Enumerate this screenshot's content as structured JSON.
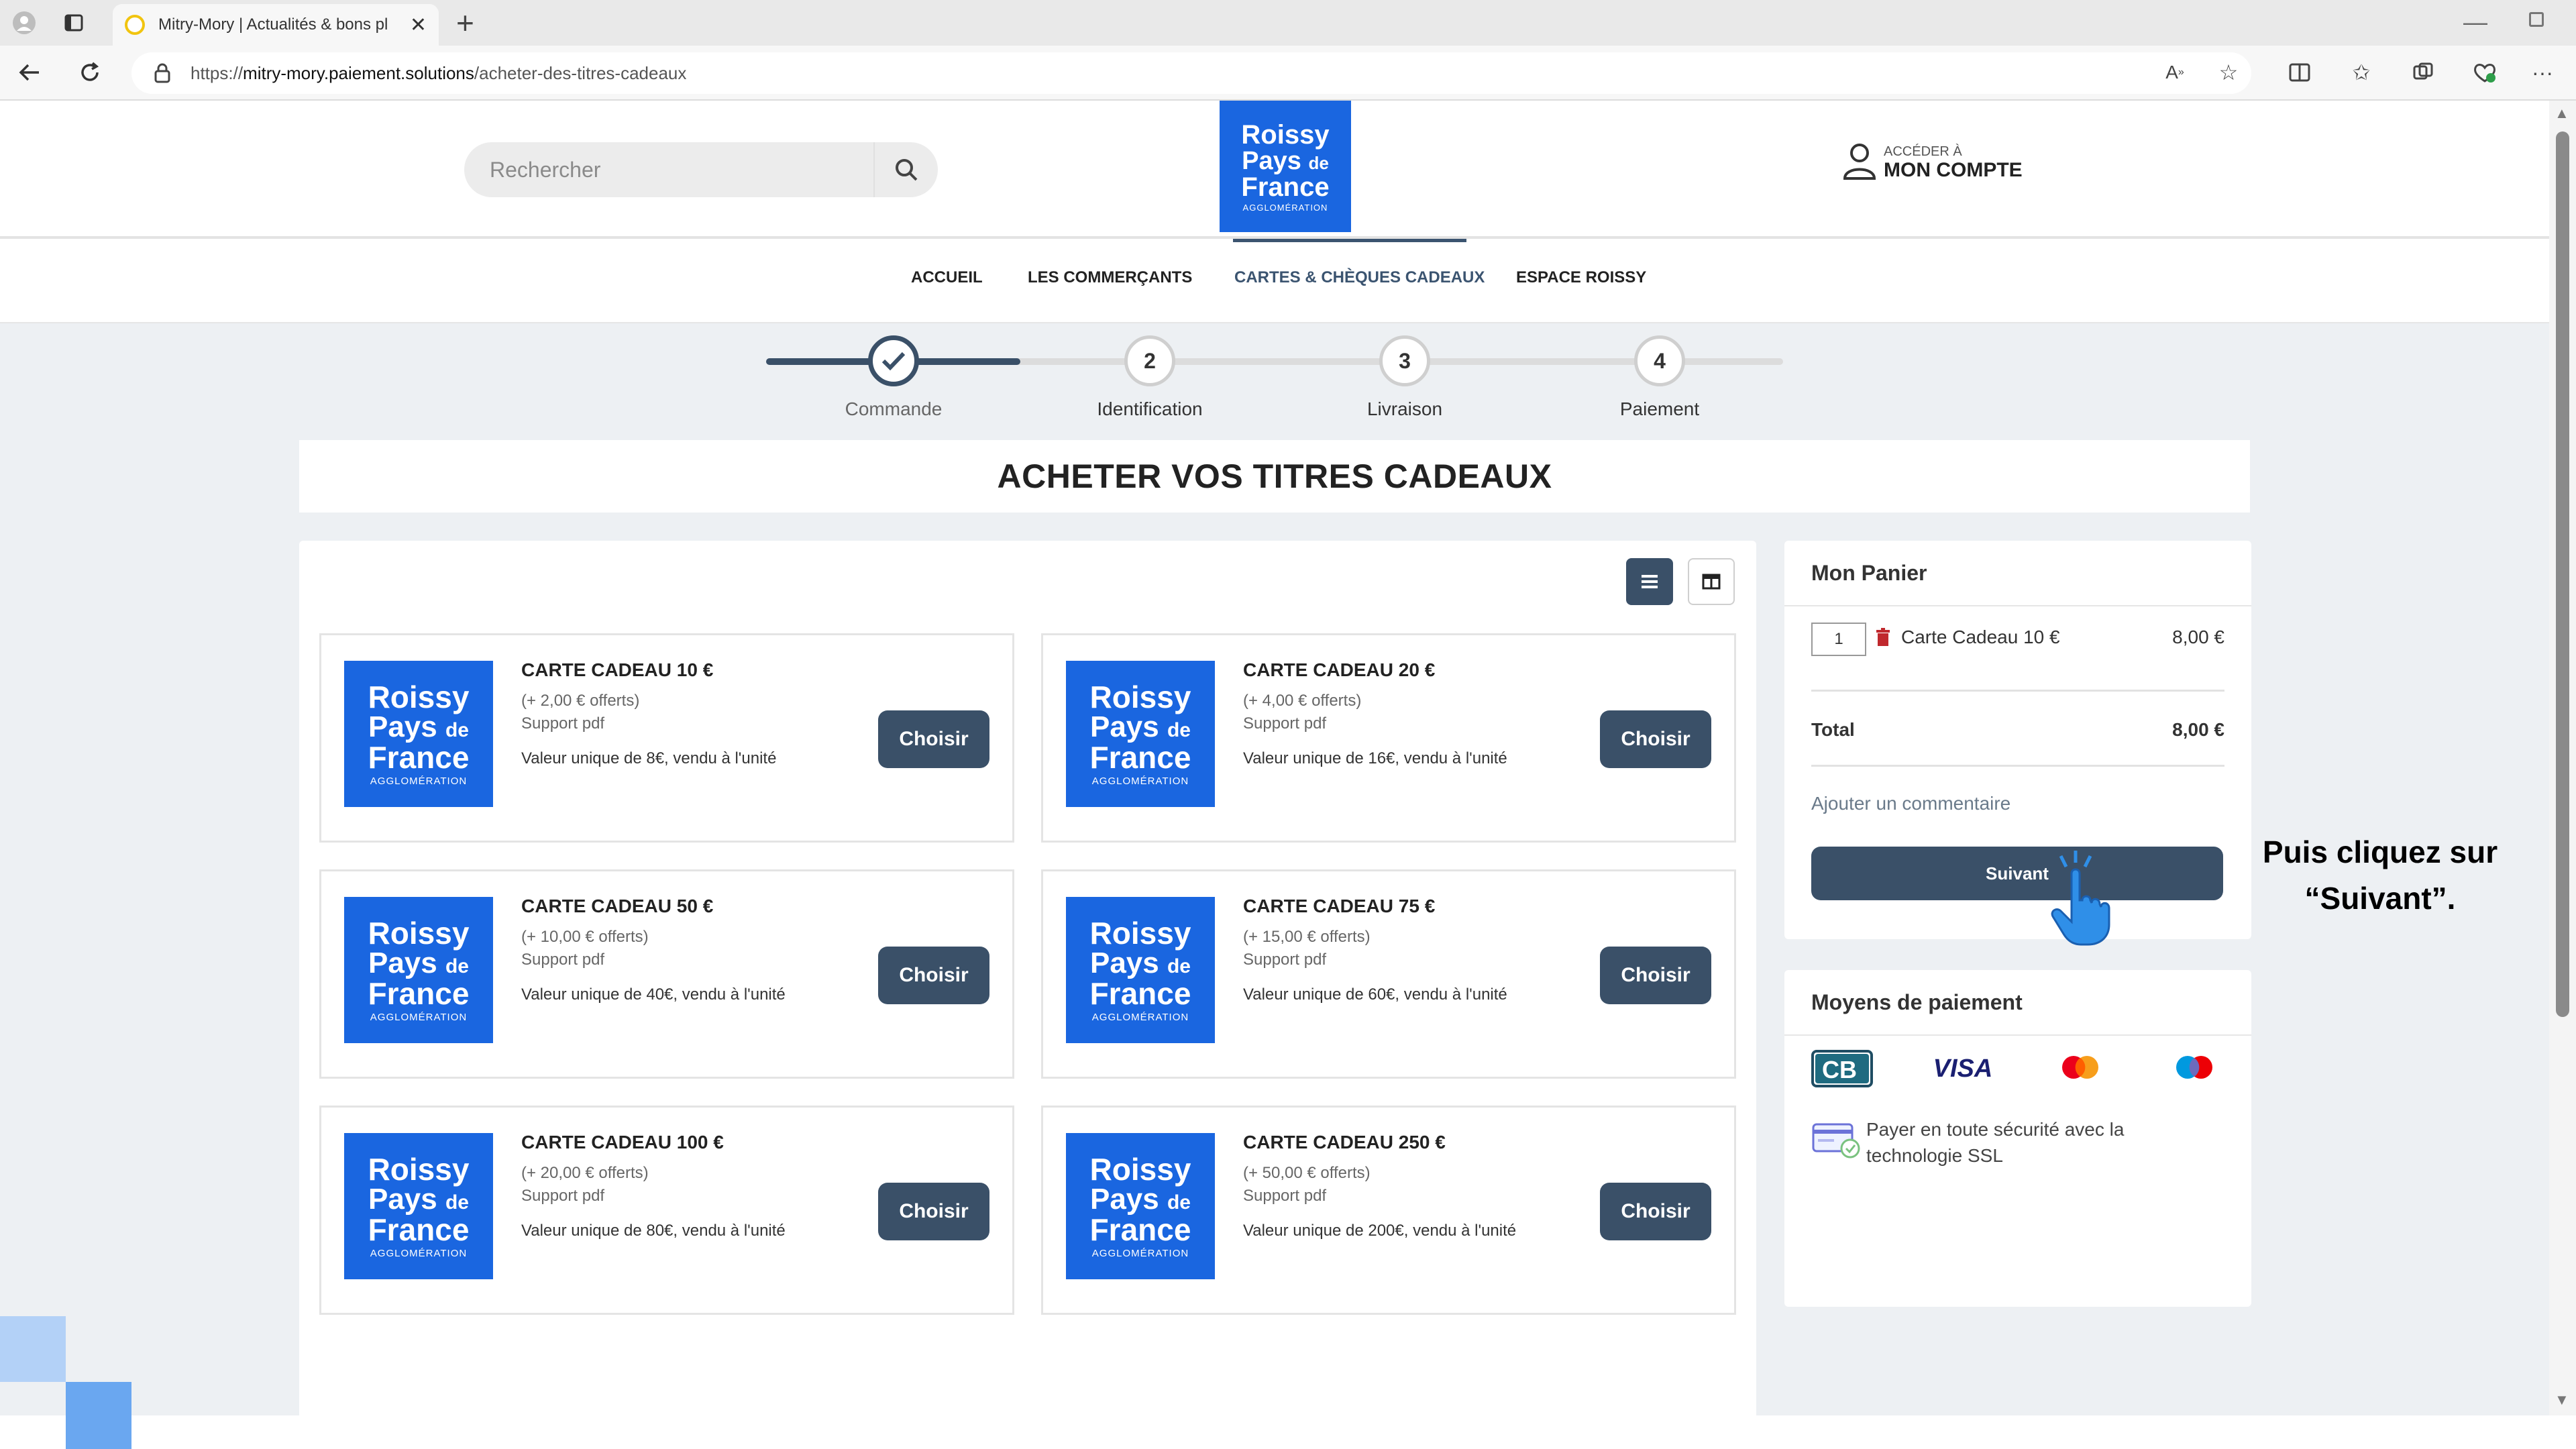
{
  "browser": {
    "tab_title": "Mitry-Mory | Actualités & bons pl",
    "url_prefix": "https://",
    "url_host": "mitry-mory.paiement.solutions",
    "url_path": "/acheter-des-titres-cadeaux"
  },
  "header": {
    "search_placeholder": "Rechercher",
    "logo": {
      "line1": "Roissy",
      "line2": "Pays",
      "line2_small": "de",
      "line3": "France",
      "line4": "AGGLOMÉRATION"
    },
    "account_small": "ACCÉDER À",
    "account_big": "MON COMPTE"
  },
  "nav": {
    "items": [
      {
        "label": "ACCUEIL"
      },
      {
        "label": "LES COMMERÇANTS"
      },
      {
        "label": "CARTES & CHÈQUES CADEAUX"
      },
      {
        "label": "ESPACE ROISSY"
      }
    ]
  },
  "stepper": {
    "progress": 0.25,
    "steps": [
      {
        "number": "",
        "label": "Commande",
        "done": true
      },
      {
        "number": "2",
        "label": "Identification"
      },
      {
        "number": "3",
        "label": "Livraison"
      },
      {
        "number": "4",
        "label": "Paiement"
      }
    ]
  },
  "page_title": "ACHETER VOS TITRES CADEAUX",
  "products": [
    {
      "name": "CARTE CADEAU 10 €",
      "bonus": "(+ 2,00 € offerts)",
      "support": "Support pdf",
      "value": "Valeur unique de 8€, vendu à l'unité",
      "button": "Choisir"
    },
    {
      "name": "CARTE CADEAU 20 €",
      "bonus": "(+ 4,00 € offerts)",
      "support": "Support pdf",
      "value": "Valeur unique de 16€, vendu à l'unité",
      "button": "Choisir"
    },
    {
      "name": "CARTE CADEAU 50 €",
      "bonus": "(+ 10,00 € offerts)",
      "support": "Support pdf",
      "value": "Valeur unique de 40€, vendu à l'unité",
      "button": "Choisir"
    },
    {
      "name": "CARTE CADEAU 75 €",
      "bonus": "(+ 15,00 € offerts)",
      "support": "Support pdf",
      "value": "Valeur unique de 60€, vendu à l'unité",
      "button": "Choisir"
    },
    {
      "name": "CARTE CADEAU 100 €",
      "bonus": "(+ 20,00 € offerts)",
      "support": "Support pdf",
      "value": "Valeur unique de 80€, vendu à l'unité",
      "button": "Choisir"
    },
    {
      "name": "CARTE CADEAU 250 €",
      "bonus": "(+ 50,00 € offerts)",
      "support": "Support pdf",
      "value": "Valeur unique de 200€, vendu à l'unité",
      "button": "Choisir"
    }
  ],
  "cart": {
    "title": "Mon Panier",
    "item_qty": "1",
    "item_name": "Carte Cadeau 10 €",
    "item_price": "8,00 €",
    "total_label": "Total",
    "total_value": "8,00 €",
    "comment_link": "Ajouter un commentaire",
    "next_button": "Suivant"
  },
  "payment": {
    "title": "Moyens de paiement",
    "logos": [
      "cb-logo",
      "visa-logo",
      "mastercard-logo",
      "maestro-logo"
    ],
    "visa_text": "VISA",
    "ssl_text": "Payer en toute sécurité avec la technologie SSL"
  },
  "annotation": {
    "line1": "Puis cliquez sur",
    "line2": "“Suivant”."
  },
  "colors": {
    "brand_blue": "#1a66e0",
    "button_dark": "#3a5068",
    "page_bg": "#edf0f3"
  }
}
